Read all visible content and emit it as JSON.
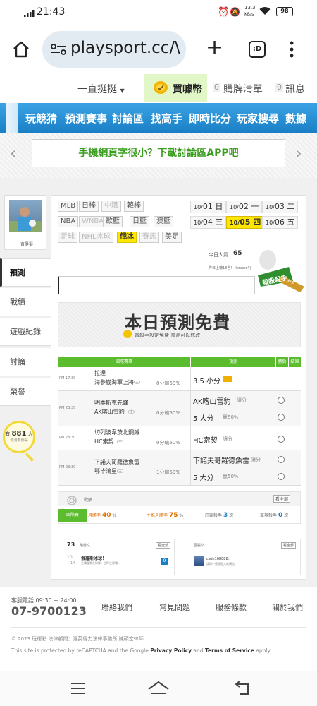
{
  "status_bar": {
    "time": "21:43",
    "net_speed": "13.3",
    "net_unit": "KB/s",
    "battery": "98"
  },
  "browser": {
    "url": "playsport.cc/\\",
    "tab_count": ":D"
  },
  "top_nav": {
    "dropdown": "一直挺挺",
    "coins": "買噱幣",
    "buy_count": "0",
    "buy_list": "購牌清單",
    "msg_count": "0",
    "messages": "訊息"
  },
  "main_nav": [
    "玩競猜",
    "預測賽事",
    "討論區",
    "找高手",
    "即時比分",
    "玩家搜尋",
    "數據"
  ],
  "banner": {
    "text": "手機網頁字很小？下載討論區APP吧"
  },
  "user": {
    "name": "一直挺挺"
  },
  "side_menu": [
    "預測",
    "戰績",
    "遊戲紀錄",
    "討論",
    "榮譽"
  ],
  "online": {
    "prefix": "有",
    "count": "881",
    "suffix": "人",
    "line2": "預測為預得"
  },
  "leagues": [
    {
      "label": "MLB",
      "state": "normal"
    },
    {
      "label": "日棒",
      "state": "normal"
    },
    {
      "label": "中職",
      "state": "dim"
    },
    {
      "label": "韓棒",
      "state": "normal"
    },
    {
      "label": "NBA",
      "state": "normal"
    },
    {
      "label": "WNBA",
      "state": "dim"
    },
    {
      "label": "歐籃",
      "state": "normal"
    },
    {
      "label": "日籃",
      "state": "normal"
    },
    {
      "label": "澳籃",
      "state": "normal"
    },
    {
      "label": "足球",
      "state": "dim"
    },
    {
      "label": "NHL冰球",
      "state": "dim"
    },
    {
      "label": "俄冰",
      "state": "active"
    },
    {
      "label": "賽馬",
      "state": "dim"
    },
    {
      "label": "美足",
      "state": "normal"
    }
  ],
  "dates": [
    {
      "m": "10/",
      "d": "01",
      "w": "日",
      "active": false
    },
    {
      "m": "10/",
      "d": "02",
      "w": "一",
      "active": false
    },
    {
      "m": "10/",
      "d": "03",
      "w": "二",
      "active": false
    },
    {
      "m": "10/",
      "d": "04",
      "w": "三",
      "active": false
    },
    {
      "m": "10/",
      "d": "05",
      "w": "四",
      "active": true
    },
    {
      "m": "10/",
      "d": "06",
      "w": "五",
      "active": false
    }
  ],
  "today_stats": {
    "label": "今日人氣",
    "value": "65",
    "rank_line": "昨日上榜18名！(lennnc4)"
  },
  "badge": {
    "text": "殺殺殺手",
    "ribbon": "殺手"
  },
  "free_banner": {
    "title": "本日預測免費",
    "subtitle": "當殺手設定免費 預測可以修改"
  },
  "table": {
    "headers": [
      "國際賽事",
      "預測",
      "勝負",
      "結果"
    ],
    "rows": [
      {
        "time": "PM 17:30",
        "team1": "拉達",
        "team2": "海參崴海軍上將",
        "t2suffix": "(主)",
        "pct": "0分輸50%",
        "picks": [
          {
            "team": "3.5 小分",
            "tag": "",
            "radio": false
          }
        ]
      },
      {
        "time": "PM 23:30",
        "team1": "明本斯克先鋒",
        "team2": "AK喀山雪豹",
        "t2suffix": "(主)",
        "pct": "0分輸50%",
        "picks": [
          {
            "team": "AK喀山雪豹",
            "tag": "讓分",
            "radio": true
          },
          {
            "team": "5 大分",
            "tag": "贏50%",
            "radio": true
          }
        ]
      },
      {
        "time": "PM 23:30",
        "team1": "切列波韋茨北鋼鐵",
        "team2": "HC索契",
        "t2suffix": "(主)",
        "pct": "0分輸50%",
        "picks": [
          {
            "team": "HC索契",
            "tag": "讓分",
            "radio": true
          }
        ]
      },
      {
        "time": "PM 23:30",
        "team1": "下諾夫哥羅德魚雷",
        "team2": "鄂毕鴻星",
        "t2suffix": "(主)",
        "pct": "1分輸50%",
        "picks": [
          {
            "team": "下諾夫哥羅德魚雷",
            "tag": "讓分",
            "radio": true
          },
          {
            "team": "5 大分",
            "tag": "贏50%",
            "radio": true
          }
        ]
      }
    ]
  },
  "record": {
    "title": "戰績",
    "view_all": "看全部",
    "kind": "國際賽",
    "items": [
      {
        "label": "月勝率",
        "value": "40",
        "unit": "%"
      },
      {
        "label": "主推月勝率",
        "value": "75",
        "unit": "%"
      },
      {
        "label": "莊家殺手",
        "value": "3",
        "unit": "次"
      },
      {
        "label": "單場殺手",
        "value": "0",
        "unit": "次"
      }
    ]
  },
  "forum": {
    "left": {
      "count": "73",
      "title": "最發文",
      "more": "看全部",
      "item_date": "10",
      "item_date2": "—14",
      "item_title": "俄羅斯冰球！",
      "item_sub": "主場優勢在球隊，主隊主客場...",
      "item_tag": "9"
    },
    "right": {
      "title": "回覆文",
      "more": "看全部",
      "item_user": "cash168888：",
      "item_sub": "請問一直挺挺大的預出"
    }
  },
  "footer": {
    "service_hours": "客服電話 09:30 ~ 24:00",
    "phone": "07-9700123",
    "links": [
      "聯絡我們",
      "常見問題",
      "服務條款",
      "關於我們"
    ],
    "copyright": "© 2023 玩運彩 法律顧問：滙英得力法律事務所 陳碩宏律師",
    "recaptcha": {
      "pre": "This site is protected by reCAPTCHA and the Google ",
      "privacy": "Privacy Policy",
      "and": " and ",
      "terms": "Terms of Service",
      "post": " apply."
    }
  }
}
